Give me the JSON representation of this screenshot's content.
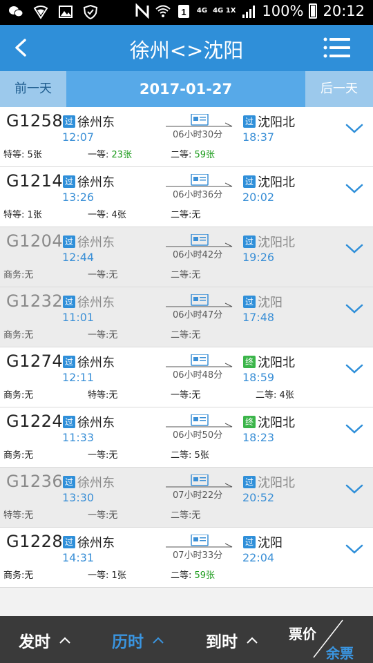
{
  "status_bar": {
    "left_icons": [
      "chat-icon",
      "wifi-shield-icon",
      "image-icon",
      "shield-check-icon"
    ],
    "battery": "100%",
    "time": "20:12",
    "network_a": "4G",
    "network_b": "4G 1X"
  },
  "header": {
    "title": "徐州<>沈阳",
    "color": "#2f8fd9"
  },
  "datebar": {
    "prev": "前一天",
    "date": "2017-01-27",
    "next": "后一天"
  },
  "trains": [
    {
      "no": "G1258",
      "from": "徐州东",
      "from_badge": "过",
      "dep": "12:07",
      "to": "沈阳北",
      "to_badge": "过",
      "arr": "18:37",
      "duration": "06小时30分",
      "dim": false,
      "seat1": "特等: 5张",
      "seat2": "一等: ",
      "seat2_hl": "23张",
      "seat3": "二等: ",
      "seat3_hl": "59张",
      "seat4": ""
    },
    {
      "no": "G1214",
      "from": "徐州东",
      "from_badge": "过",
      "dep": "13:26",
      "to": "沈阳北",
      "to_badge": "过",
      "arr": "20:02",
      "duration": "06小时36分",
      "dim": false,
      "seat1": "特等: 1张",
      "seat2": "一等: 4张",
      "seat2_hl": "",
      "seat3": "二等:无",
      "seat3_hl": "",
      "seat4": ""
    },
    {
      "no": "G1204",
      "from": "徐州东",
      "from_badge": "过",
      "dep": "12:44",
      "to": "沈阳北",
      "to_badge": "过",
      "arr": "19:26",
      "duration": "06小时42分",
      "dim": true,
      "seat1": "商务:无",
      "seat2": "一等:无",
      "seat2_hl": "",
      "seat3": "二等:无",
      "seat3_hl": "",
      "seat4": ""
    },
    {
      "no": "G1232",
      "from": "徐州东",
      "from_badge": "过",
      "dep": "11:01",
      "to": "沈阳",
      "to_badge": "过",
      "arr": "17:48",
      "duration": "06小时47分",
      "dim": true,
      "seat1": "商务:无",
      "seat2": "一等:无",
      "seat2_hl": "",
      "seat3": "二等:无",
      "seat3_hl": "",
      "seat4": ""
    },
    {
      "no": "G1274",
      "from": "徐州东",
      "from_badge": "过",
      "dep": "12:11",
      "to": "沈阳北",
      "to_badge": "终",
      "arr": "18:59",
      "duration": "06小时48分",
      "dim": false,
      "seat1": "商务:无",
      "seat2": "特等:无",
      "seat2_hl": "",
      "seat3": "一等:无",
      "seat3_hl": "",
      "seat4": "二等: 4张"
    },
    {
      "no": "G1224",
      "from": "徐州东",
      "from_badge": "过",
      "dep": "11:33",
      "to": "沈阳北",
      "to_badge": "终",
      "arr": "18:23",
      "duration": "06小时50分",
      "dim": false,
      "seat1": "商务:无",
      "seat2": "一等:无",
      "seat2_hl": "",
      "seat3": "二等: 5张",
      "seat3_hl": "",
      "seat4": ""
    },
    {
      "no": "G1236",
      "from": "徐州东",
      "from_badge": "过",
      "dep": "13:30",
      "to": "沈阳北",
      "to_badge": "过",
      "arr": "20:52",
      "duration": "07小时22分",
      "dim": true,
      "seat1": "特等:无",
      "seat2": "一等:无",
      "seat2_hl": "",
      "seat3": "二等:无",
      "seat3_hl": "",
      "seat4": ""
    },
    {
      "no": "G1228",
      "from": "徐州东",
      "from_badge": "过",
      "dep": "14:31",
      "to": "沈阳",
      "to_badge": "过",
      "arr": "22:04",
      "duration": "07小时33分",
      "dim": false,
      "seat1": "商务:无",
      "seat2": "一等: 1张",
      "seat2_hl": "",
      "seat3": "二等: ",
      "seat3_hl": "59张",
      "seat4": ""
    }
  ],
  "bottom": {
    "sort_dep": "发时",
    "sort_dur": "历时",
    "sort_arr": "到时",
    "price": "票价",
    "remain": "余票",
    "active_color": "#3a95e0"
  }
}
